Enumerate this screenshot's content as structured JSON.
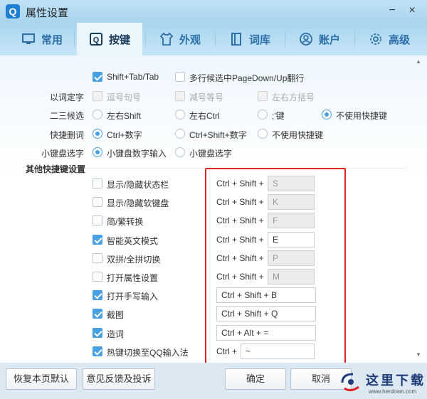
{
  "window": {
    "title": "属性设置",
    "app_icon_letter": "Q",
    "minimize_glyph": "−",
    "close_glyph": "×"
  },
  "tabs": [
    {
      "label": "常用",
      "icon": "monitor-icon",
      "active": false
    },
    {
      "label": "按键",
      "icon": "keyboard-q-icon",
      "active": true
    },
    {
      "label": "外观",
      "icon": "tshirt-icon",
      "active": false
    },
    {
      "label": "词库",
      "icon": "book-icon",
      "active": false
    },
    {
      "label": "账户",
      "icon": "user-icon",
      "active": false
    },
    {
      "label": "高级",
      "icon": "gear-icon",
      "active": false
    }
  ],
  "top_options": {
    "shift_tab": {
      "label": "Shift+Tab/Tab",
      "checked": true
    },
    "multi_row": {
      "label": "多行候选中PageDown/Up翻行",
      "checked": false
    }
  },
  "rows": {
    "yi_ci_ding_zi": {
      "label": "以词定字",
      "options": [
        {
          "label": "逗号句号",
          "disabled": true
        },
        {
          "label": "减号等号",
          "disabled": true
        },
        {
          "label": "左右方括号",
          "disabled": true
        }
      ]
    },
    "er_san_hou_xuan": {
      "label": "二三候选",
      "options": [
        {
          "label": "左右Shift",
          "selected": false
        },
        {
          "label": "左右Ctrl",
          "selected": false
        },
        {
          "label": ";'键",
          "selected": false
        },
        {
          "label": "不使用快捷键",
          "selected": true
        }
      ]
    },
    "kuai_jie_shan_ci": {
      "label": "快捷删词",
      "options": [
        {
          "label": "Ctrl+数字",
          "selected": true
        },
        {
          "label": "Ctrl+Shift+数字",
          "selected": false
        },
        {
          "label": "不使用快捷键",
          "selected": false
        }
      ]
    },
    "xiao_jian_pan": {
      "label": "小键盘选字",
      "options": [
        {
          "label": "小键盘数字输入",
          "selected": true
        },
        {
          "label": "小键盘选字",
          "selected": false
        }
      ]
    }
  },
  "section_title": "其他快捷键设置",
  "hotkeys": [
    {
      "label": "显示/隐藏状态栏",
      "checked": false,
      "prefix": "Ctrl + Shift +",
      "key": "S",
      "enabled": false
    },
    {
      "label": "显示/隐藏软键盘",
      "checked": false,
      "prefix": "Ctrl + Shift +",
      "key": "K",
      "enabled": false
    },
    {
      "label": "简/繁转换",
      "checked": false,
      "prefix": "Ctrl + Shift +",
      "key": "F",
      "enabled": false
    },
    {
      "label": "智能英文模式",
      "checked": true,
      "prefix": "Ctrl + Shift +",
      "key": "E",
      "enabled": true
    },
    {
      "label": "双拼/全拼切换",
      "checked": false,
      "prefix": "Ctrl + Shift +",
      "key": "P",
      "enabled": false
    },
    {
      "label": "打开属性设置",
      "checked": false,
      "prefix": "Ctrl + Shift +",
      "key": "M",
      "enabled": false
    },
    {
      "label": "打开手写输入",
      "checked": true,
      "field": "Ctrl + Shift + B"
    },
    {
      "label": "截图",
      "checked": true,
      "field": "Ctrl + Shift + Q"
    },
    {
      "label": "造词",
      "checked": true,
      "field": "Ctrl + Alt + ="
    },
    {
      "label": "热键切换至QQ输入法",
      "checked": true,
      "prefix": "Ctrl +",
      "key": "~",
      "enabled": true
    }
  ],
  "footer": {
    "restore_default": "恢复本页默认",
    "feedback": "意见反馈及投诉",
    "ok": "确定",
    "cancel": "取消"
  },
  "watermark": {
    "text": "这里下载",
    "url": "www.herdown.com"
  },
  "colors": {
    "accent": "#4a9fe0",
    "highlight_box": "#e02424",
    "titlebar": "#a9d5f0"
  }
}
